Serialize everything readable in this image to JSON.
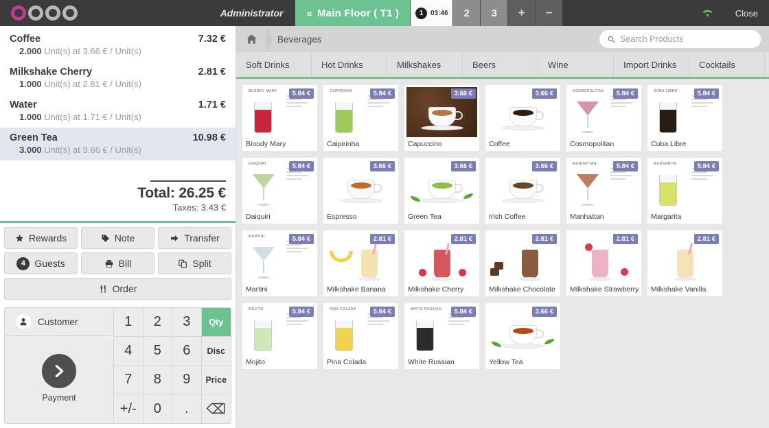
{
  "topbar": {
    "brand": "odoo",
    "user": "Administrator",
    "floor_button": "Main Floor ( T1 )",
    "floor_chevron": "«",
    "tables": [
      {
        "label": "1",
        "time": "03:46",
        "active": true
      },
      {
        "label": "2",
        "active": false
      },
      {
        "label": "3",
        "active": false
      }
    ],
    "add_label": "+",
    "remove_label": "−",
    "wifi_icon": "wifi-icon",
    "close_label": "Close"
  },
  "order": {
    "lines": [
      {
        "name": "Coffee",
        "qty": "2.000",
        "unit": "Unit(s) at 3.66 € / Unit(s)",
        "price": "7.32 €",
        "selected": false
      },
      {
        "name": "Milkshake Cherry",
        "qty": "1.000",
        "unit": "Unit(s) at 2.81 € / Unit(s)",
        "price": "2.81 €",
        "selected": false
      },
      {
        "name": "Water",
        "qty": "1.000",
        "unit": "Unit(s) at 1.71 € / Unit(s)",
        "price": "1.71 €",
        "selected": false
      },
      {
        "name": "Green Tea",
        "qty": "3.000",
        "unit": "Unit(s) at 3.66 € / Unit(s)",
        "price": "10.98 €",
        "selected": true
      }
    ],
    "total_label": "Total: 26.25 €",
    "taxes_label": "Taxes: 3.43 €"
  },
  "actions": {
    "rewards": "Rewards",
    "note": "Note",
    "transfer": "Transfer",
    "guests": "Guests",
    "guests_count": "4",
    "bill": "Bill",
    "split": "Split",
    "order": "Order"
  },
  "numpad": {
    "customer_label": "Customer",
    "payment_label": "Payment",
    "keys": [
      {
        "label": "1",
        "type": "digit"
      },
      {
        "label": "2",
        "type": "digit"
      },
      {
        "label": "3",
        "type": "digit"
      },
      {
        "label": "Qty",
        "type": "mode",
        "active": true
      },
      {
        "label": "4",
        "type": "digit"
      },
      {
        "label": "5",
        "type": "digit"
      },
      {
        "label": "6",
        "type": "digit"
      },
      {
        "label": "Disc",
        "type": "mode",
        "active": false
      },
      {
        "label": "7",
        "type": "digit"
      },
      {
        "label": "8",
        "type": "digit"
      },
      {
        "label": "9",
        "type": "digit"
      },
      {
        "label": "Price",
        "type": "mode",
        "active": false
      },
      {
        "label": "+/-",
        "type": "digit"
      },
      {
        "label": "0",
        "type": "digit"
      },
      {
        "label": ".",
        "type": "digit"
      },
      {
        "label": "⌫",
        "type": "backspace"
      }
    ]
  },
  "breadcrumb": {
    "home_icon": "home-icon",
    "category": "Beverages"
  },
  "search": {
    "icon": "search-icon",
    "placeholder": "Search Products"
  },
  "categories": [
    {
      "label": "Soft Drinks"
    },
    {
      "label": "Hot Drinks"
    },
    {
      "label": "Milkshakes"
    },
    {
      "label": "Beers"
    },
    {
      "label": "Wine"
    },
    {
      "label": "Import Drinks"
    },
    {
      "label": "Cocktails"
    }
  ],
  "accent": {
    "green": "#6cc291",
    "badge_purple": "#7b7db5",
    "dark": "#3b3b3b",
    "selected_row": "#e3e6ef"
  },
  "products": [
    {
      "name": "Bloody Mary",
      "price": "5.84 €",
      "art": "cocktail-tall",
      "color": "#c9263c",
      "caption": "BLOODY MARY"
    },
    {
      "name": "Caipirinha",
      "price": "5.84 €",
      "art": "cocktail-tall",
      "color": "#9fca5a",
      "caption": "CAIPIRINHA"
    },
    {
      "name": "Capuccino",
      "price": "3.66 €",
      "art": "coffee-beans",
      "color": "#b07a46",
      "caption": ""
    },
    {
      "name": "Coffee",
      "price": "3.66 €",
      "art": "coffee-cup",
      "color": "#30180c",
      "caption": ""
    },
    {
      "name": "Cosmopolitan",
      "price": "5.84 €",
      "art": "cocktail-martini",
      "color": "#e2808e",
      "caption": "COSMOPOLITAN"
    },
    {
      "name": "Cuba Libre",
      "price": "5.84 €",
      "art": "cocktail-tall",
      "color": "#2b1a10",
      "caption": "CUBA LIBRE"
    },
    {
      "name": "Daiquiri",
      "price": "5.84 €",
      "art": "cocktail-martini",
      "color": "#c4dd8c",
      "caption": "DAIQUIRI"
    },
    {
      "name": "Espresso",
      "price": "3.66 €",
      "art": "coffee-cup",
      "color": "#c26a28",
      "caption": ""
    },
    {
      "name": "Green Tea",
      "price": "3.66 €",
      "art": "tea-cup",
      "color": "#8fbc4a",
      "caption": ""
    },
    {
      "name": "Irish Coffee",
      "price": "3.66 €",
      "art": "coffee-cup",
      "color": "#6b4528",
      "caption": ""
    },
    {
      "name": "Manhattan",
      "price": "5.84 €",
      "art": "cocktail-martini",
      "color": "#c4562a",
      "caption": "MANHATTAN"
    },
    {
      "name": "Margarita",
      "price": "5.84 €",
      "art": "cocktail-tall",
      "color": "#d8e06a",
      "caption": "MARGARITA"
    },
    {
      "name": "Martini",
      "price": "5.84 €",
      "art": "cocktail-martini",
      "color": "#dff0ea",
      "caption": "MARTINI"
    },
    {
      "name": "Milkshake Banana",
      "price": "2.81 €",
      "art": "shake-banana",
      "color": "#f3e3b0",
      "caption": ""
    },
    {
      "name": "Milkshake Cherry",
      "price": "2.81 €",
      "art": "shake-cherry",
      "color": "#d4565f",
      "caption": ""
    },
    {
      "name": "Milkshake Chocolate",
      "price": "2.81 €",
      "art": "shake-chocolate",
      "color": "#8a5b3c",
      "caption": ""
    },
    {
      "name": "Milkshake Strawberry",
      "price": "2.81 €",
      "art": "shake-strawberry",
      "color": "#eeb2c4",
      "caption": ""
    },
    {
      "name": "Milkshake Vanilla",
      "price": "2.81 €",
      "art": "shake-vanilla",
      "color": "#f2e3bb",
      "caption": ""
    },
    {
      "name": "Mojito",
      "price": "5.84 €",
      "art": "cocktail-tall",
      "color": "#cfe8b6",
      "caption": "MOJITO"
    },
    {
      "name": "Pina Colada",
      "price": "5.84 €",
      "art": "cocktail-tall",
      "color": "#f0d44f",
      "caption": "PINA COLADA"
    },
    {
      "name": "White Russian",
      "price": "5.84 €",
      "art": "cocktail-tall",
      "color": "#2b2b2b",
      "caption": "WHITE RUSSIAN"
    },
    {
      "name": "Yellow Tea",
      "price": "3.66 €",
      "art": "tea-cup",
      "color": "#b24a12",
      "caption": ""
    }
  ]
}
